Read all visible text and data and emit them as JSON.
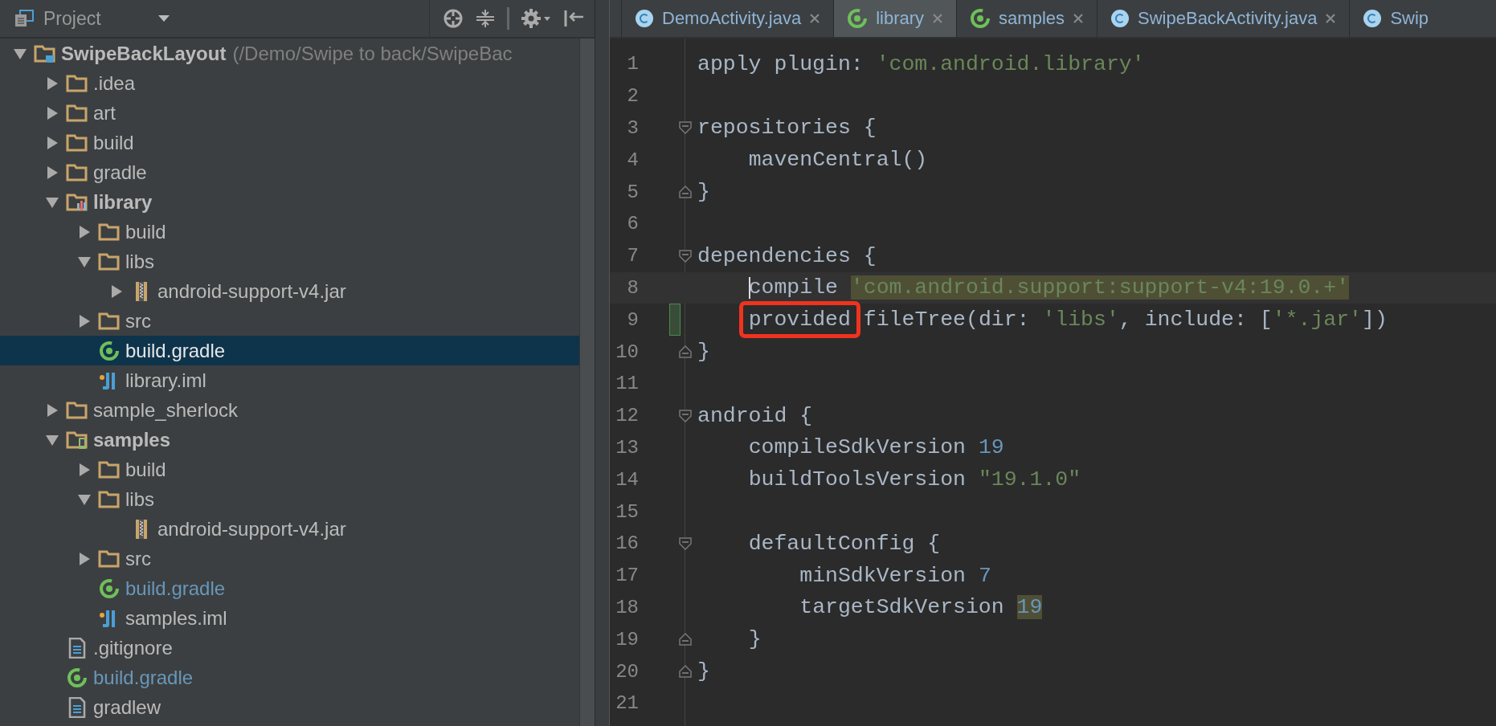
{
  "project_panel": {
    "title": "Project"
  },
  "project_tree": [
    {
      "label": "SwipeBackLayout",
      "suffix": "(/Demo/Swipe to back/SwipeBac",
      "kind": "project",
      "expanded": true,
      "selected": false,
      "children": [
        {
          "label": ".idea",
          "kind": "folder",
          "expanded": false,
          "selected": false
        },
        {
          "label": "art",
          "kind": "folder",
          "expanded": false,
          "selected": false
        },
        {
          "label": "build",
          "kind": "folder",
          "expanded": false,
          "selected": false
        },
        {
          "label": "gradle",
          "kind": "folder",
          "expanded": false,
          "selected": false
        },
        {
          "label": "library",
          "kind": "library-module",
          "expanded": true,
          "selected": false,
          "children": [
            {
              "label": "build",
              "kind": "folder",
              "expanded": false,
              "selected": false
            },
            {
              "label": "libs",
              "kind": "folder",
              "expanded": true,
              "selected": false,
              "children": [
                {
                  "label": "android-support-v4.jar",
                  "kind": "jar",
                  "expanded": false,
                  "selected": false
                }
              ]
            },
            {
              "label": "src",
              "kind": "folder",
              "expanded": false,
              "selected": false
            },
            {
              "label": "build.gradle",
              "kind": "gradle",
              "selected": true
            },
            {
              "label": "library.iml",
              "kind": "iml",
              "selected": false
            }
          ]
        },
        {
          "label": "sample_sherlock",
          "kind": "folder",
          "expanded": false,
          "selected": false
        },
        {
          "label": "samples",
          "kind": "app-module",
          "expanded": true,
          "selected": false,
          "children": [
            {
              "label": "build",
              "kind": "folder",
              "expanded": false,
              "selected": false
            },
            {
              "label": "libs",
              "kind": "folder",
              "expanded": true,
              "selected": false,
              "children": [
                {
                  "label": "android-support-v4.jar",
                  "kind": "jar",
                  "selected": false
                }
              ]
            },
            {
              "label": "src",
              "kind": "folder",
              "expanded": false,
              "selected": false
            },
            {
              "label": "build.gradle",
              "kind": "gradle",
              "selected": false,
              "color": "#6897bb"
            },
            {
              "label": "samples.iml",
              "kind": "iml",
              "selected": false
            }
          ]
        },
        {
          "label": ".gitignore",
          "kind": "file",
          "selected": false
        },
        {
          "label": "build.gradle",
          "kind": "gradle",
          "selected": false,
          "color": "#6897bb"
        },
        {
          "label": "gradlew",
          "kind": "file",
          "selected": false
        }
      ]
    }
  ],
  "tabs": [
    {
      "label": "DemoActivity.java",
      "kind": "class",
      "selected": false,
      "closable": true
    },
    {
      "label": "library",
      "kind": "gradle",
      "selected": true,
      "closable": true
    },
    {
      "label": "samples",
      "kind": "gradle",
      "selected": false,
      "closable": true
    },
    {
      "label": "SwipeBackActivity.java",
      "kind": "class",
      "selected": false,
      "closable": true
    },
    {
      "label": "Swip",
      "kind": "class",
      "selected": false,
      "closable": false
    }
  ],
  "editor": {
    "lines": [
      {
        "number": "1",
        "kind": "plain",
        "current": false,
        "changed": false,
        "tokens": [
          {
            "text": "apply plugin: ",
            "kind": "plain"
          },
          {
            "text": "'com.android.library'",
            "kind": "string"
          }
        ]
      },
      {
        "number": "2",
        "kind": "plain",
        "current": false,
        "changed": false
      },
      {
        "number": "3",
        "kind": "open",
        "current": false,
        "changed": false,
        "tokens": [
          {
            "text": "repositories {",
            "kind": "plain"
          }
        ]
      },
      {
        "number": "4",
        "kind": "plain",
        "current": false,
        "changed": false,
        "tokens": [
          {
            "text": "    mavenCentral()",
            "kind": "plain"
          }
        ]
      },
      {
        "number": "5",
        "kind": "close",
        "current": false,
        "changed": false,
        "tokens": [
          {
            "text": "}",
            "kind": "plain"
          }
        ]
      },
      {
        "number": "6",
        "kind": "plain",
        "current": false,
        "changed": false
      },
      {
        "number": "7",
        "kind": "open",
        "current": false,
        "changed": false,
        "tokens": [
          {
            "text": "dependencies {",
            "kind": "plain"
          }
        ]
      },
      {
        "number": "8",
        "kind": "plain",
        "current": true,
        "changed": false,
        "tokens": [
          {
            "text": "    compile ",
            "kind": "plain",
            "caret": true
          },
          {
            "text": "'com.android.support:support-v4:19.0.+'",
            "kind": "string",
            "highlighted": true
          }
        ]
      },
      {
        "number": "9",
        "kind": "plain",
        "current": false,
        "changed": true,
        "tokens": [
          {
            "text": "    provided",
            "kind": "plain",
            "boxed": true
          },
          {
            "text": " fileTree(dir: ",
            "kind": "plain"
          },
          {
            "text": "'libs'",
            "kind": "string"
          },
          {
            "text": ", include: [",
            "kind": "plain"
          },
          {
            "text": "'*.jar'",
            "kind": "string"
          },
          {
            "text": "])",
            "kind": "plain"
          }
        ]
      },
      {
        "number": "10",
        "kind": "close",
        "current": false,
        "changed": false,
        "tokens": [
          {
            "text": "}",
            "kind": "plain"
          }
        ]
      },
      {
        "number": "11",
        "kind": "plain",
        "current": false,
        "changed": false
      },
      {
        "number": "12",
        "kind": "open",
        "current": false,
        "changed": false,
        "tokens": [
          {
            "text": "android {",
            "kind": "plain"
          }
        ]
      },
      {
        "number": "13",
        "kind": "plain",
        "current": false,
        "changed": false,
        "tokens": [
          {
            "text": "    compileSdkVersion ",
            "kind": "plain"
          },
          {
            "text": "19",
            "kind": "number"
          }
        ]
      },
      {
        "number": "14",
        "kind": "plain",
        "current": false,
        "changed": false,
        "tokens": [
          {
            "text": "    buildToolsVersion ",
            "kind": "plain"
          },
          {
            "text": "\"19.1.0\"",
            "kind": "string"
          }
        ]
      },
      {
        "number": "15",
        "kind": "plain",
        "current": false,
        "changed": false
      },
      {
        "number": "16",
        "kind": "open",
        "current": false,
        "changed": false,
        "tokens": [
          {
            "text": "    defaultConfig {",
            "kind": "plain"
          }
        ]
      },
      {
        "number": "17",
        "kind": "plain",
        "current": false,
        "changed": false,
        "tokens": [
          {
            "text": "        minSdkVersion ",
            "kind": "plain"
          },
          {
            "text": "7",
            "kind": "number"
          }
        ]
      },
      {
        "number": "18",
        "kind": "plain",
        "current": false,
        "changed": false,
        "tokens": [
          {
            "text": "        targetSdkVersion ",
            "kind": "plain"
          },
          {
            "text": "19",
            "kind": "number",
            "highlighted": true
          }
        ]
      },
      {
        "number": "19",
        "kind": "close",
        "current": false,
        "changed": false,
        "tokens": [
          {
            "text": "    }",
            "kind": "plain"
          }
        ]
      },
      {
        "number": "20",
        "kind": "close",
        "current": false,
        "changed": false,
        "tokens": [
          {
            "text": "}",
            "kind": "plain"
          }
        ]
      },
      {
        "number": "21",
        "kind": "plain",
        "current": false,
        "changed": false
      }
    ]
  }
}
